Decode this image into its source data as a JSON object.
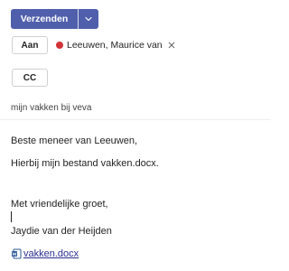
{
  "toolbar": {
    "send_label": "Verzenden",
    "send_dropdown_icon": "chevron-down-icon",
    "accent_color": "#4f5fab"
  },
  "recipients": {
    "to_label": "Aan",
    "cc_label": "CC",
    "to_chips": [
      {
        "name": "Leeuwen, Maurice van",
        "presence_color": "#d13438",
        "remove_icon": "close-icon"
      }
    ]
  },
  "subject": {
    "value": "mijn vakken bij veva"
  },
  "body": {
    "greeting": "Beste meneer van Leeuwen,",
    "line1": "Hierbij mijn bestand vakken.docx.",
    "closing": "Met vriendelijke groet,",
    "signature": "Jaydie van der Heijden",
    "attachment": {
      "label": "vakken.docx",
      "icon": "word-document-icon",
      "link_color": "#2b2f8f"
    }
  }
}
